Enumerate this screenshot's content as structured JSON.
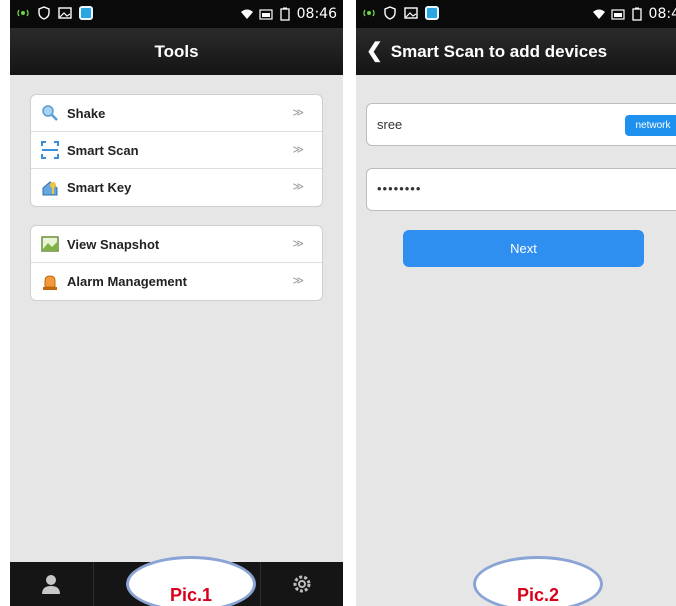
{
  "pic1": {
    "status_time": "08:46",
    "title": "Tools",
    "groups": [
      [
        {
          "label": "Shake",
          "icon": "magnifier-icon"
        },
        {
          "label": "Smart Scan",
          "icon": "scan-icon"
        },
        {
          "label": "Smart Key",
          "icon": "key-icon"
        }
      ],
      [
        {
          "label": "View Snapshot",
          "icon": "picture-icon"
        },
        {
          "label": "Alarm Management",
          "icon": "alarm-icon"
        }
      ]
    ],
    "chevron": "≫",
    "bubble": "Pic.1"
  },
  "pic2": {
    "status_time": "08:4",
    "back_glyph": "❮",
    "title": "Smart Scan to add devices",
    "ssid_value": "sree",
    "network_button": "network",
    "password_mask": "••••••••",
    "next_button": "Next",
    "bubble": "Pic.2"
  },
  "colors": {
    "accent_blue": "#1e90ee",
    "bubble_text": "#d8001b",
    "bubble_border": "#8aa4d6"
  }
}
